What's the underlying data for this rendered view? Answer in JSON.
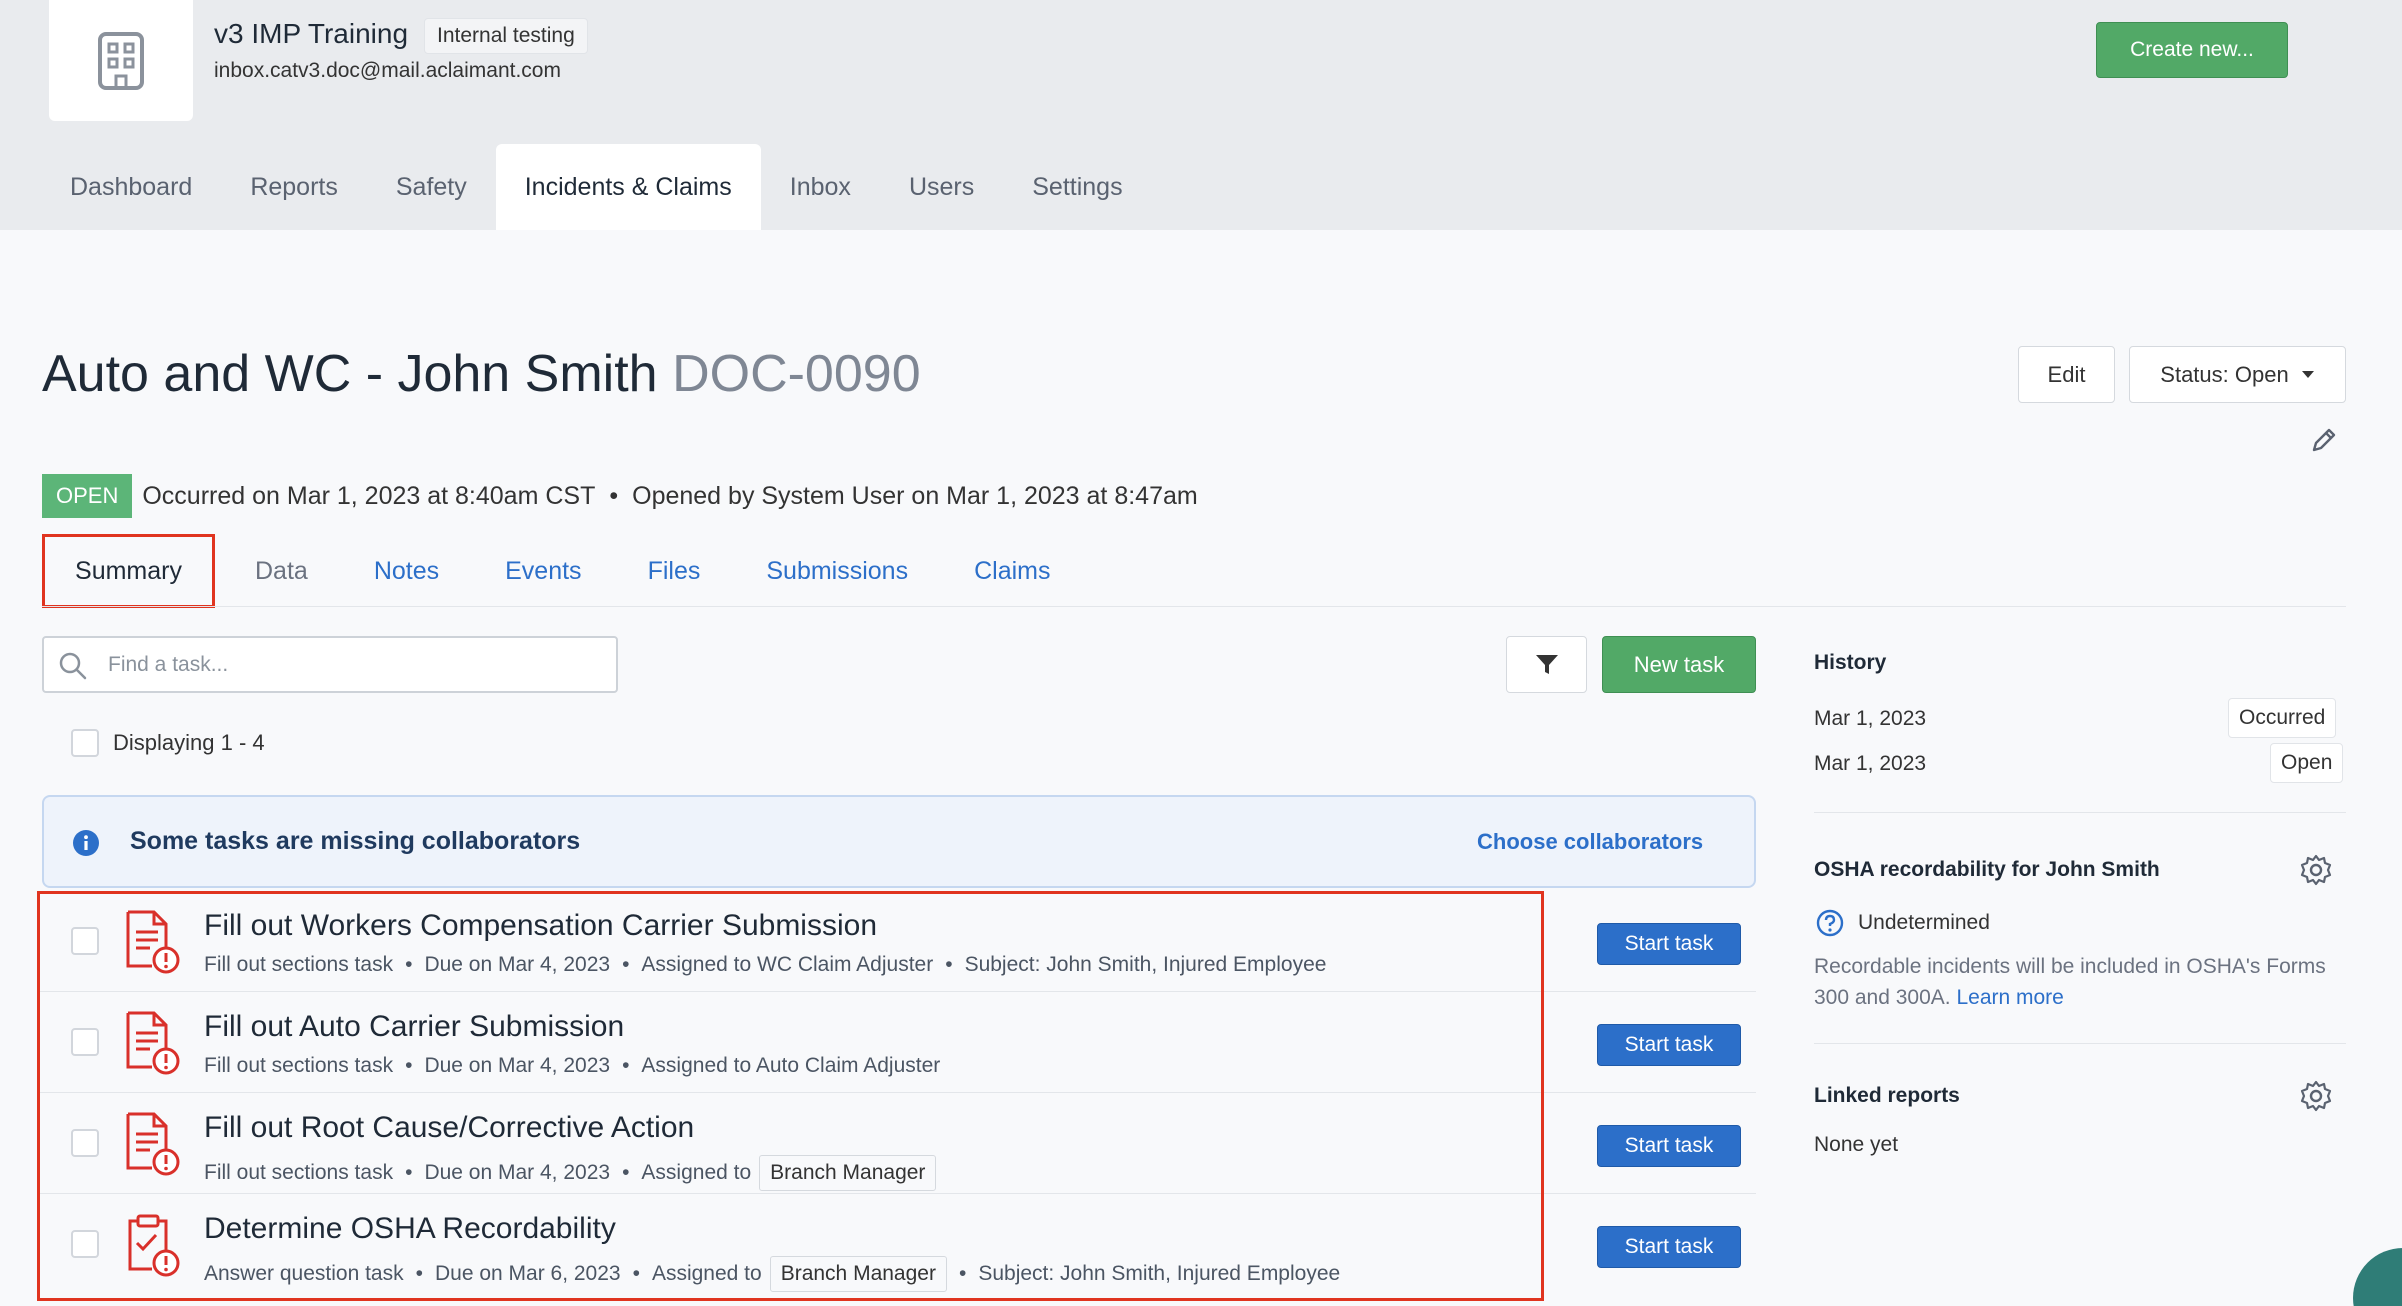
{
  "org": {
    "name": "v3 IMP Training",
    "badge": "Internal testing",
    "email": "inbox.catv3.doc@mail.aclaimant.com",
    "create_label": "Create new..."
  },
  "nav": {
    "items": [
      {
        "label": "Dashboard"
      },
      {
        "label": "Reports"
      },
      {
        "label": "Safety"
      },
      {
        "label": "Incidents & Claims",
        "active": true
      },
      {
        "label": "Inbox"
      },
      {
        "label": "Users"
      },
      {
        "label": "Settings"
      }
    ]
  },
  "incident": {
    "title": "Auto and WC - John Smith",
    "doc_id": "DOC-0090",
    "edit_label": "Edit",
    "status_label": "Status: Open",
    "status_badge": "OPEN",
    "occurred": "Occurred on Mar 1, 2023 at 8:40am CST",
    "dot": "•",
    "opened": "Opened by System User on Mar 1, 2023 at 8:47am"
  },
  "tabs": [
    {
      "label": "Summary",
      "active": true
    },
    {
      "label": "Data"
    },
    {
      "label": "Notes"
    },
    {
      "label": "Events"
    },
    {
      "label": "Files"
    },
    {
      "label": "Submissions"
    },
    {
      "label": "Claims"
    }
  ],
  "toolbar": {
    "search_placeholder": "Find a task...",
    "new_task_label": "New task",
    "displaying": "Displaying 1 - 4"
  },
  "banner": {
    "text": "Some tasks are missing collaborators",
    "link": "Choose collaborators"
  },
  "tasks": [
    {
      "title": "Fill out Workers Compensation Carrier Submission",
      "type": "Fill out sections task",
      "due": "Due on Mar 4, 2023",
      "assigned_prefix": "Assigned to WC Claim Adjuster",
      "subject": "Subject: John Smith, Injured Employee",
      "start_label": "Start task"
    },
    {
      "title": "Fill out Auto Carrier Submission",
      "type": "Fill out sections task",
      "due": "Due on Mar 4, 2023",
      "assigned_prefix": "Assigned to Auto Claim Adjuster",
      "start_label": "Start task"
    },
    {
      "title": "Fill out Root Cause/Corrective Action",
      "type": "Fill out sections task",
      "due": "Due on Mar 4, 2023",
      "assigned_prefix": "Assigned to",
      "assignee_chip": "Branch Manager",
      "start_label": "Start task"
    },
    {
      "title": "Determine OSHA Recordability",
      "type": "Answer question task",
      "due": "Due on Mar 6, 2023",
      "assigned_prefix": "Assigned to",
      "assignee_chip": "Branch Manager",
      "subject": "Subject: John Smith, Injured Employee",
      "start_label": "Start task"
    }
  ],
  "sidebar": {
    "history": {
      "title": "History",
      "entries": [
        {
          "date": "Mar 1, 2023",
          "event": "Occurred"
        },
        {
          "date": "Mar 1, 2023",
          "event": "Open"
        }
      ]
    },
    "osha": {
      "title": "OSHA recordability for John Smith",
      "status": "Undetermined",
      "description": "Recordable incidents will be included in OSHA's Forms 300 and 300A.",
      "learn_more": "Learn more"
    },
    "linked": {
      "title": "Linked reports",
      "empty": "None yet"
    }
  },
  "icons": {
    "logo": "building-icon",
    "filter": "filter-icon",
    "search": "search-icon",
    "info": "info-icon",
    "task_doc": "document-alert-icon",
    "task_clipboard": "clipboard-alert-icon",
    "gear": "gear-icon",
    "pencil": "pencil-icon",
    "caret": "caret-down-icon",
    "question": "question-circle-icon"
  },
  "colors": {
    "green": "#52a967",
    "blue": "#2c6fc9",
    "red_highlight": "#e0341f",
    "task_icon": "#d9302a"
  }
}
